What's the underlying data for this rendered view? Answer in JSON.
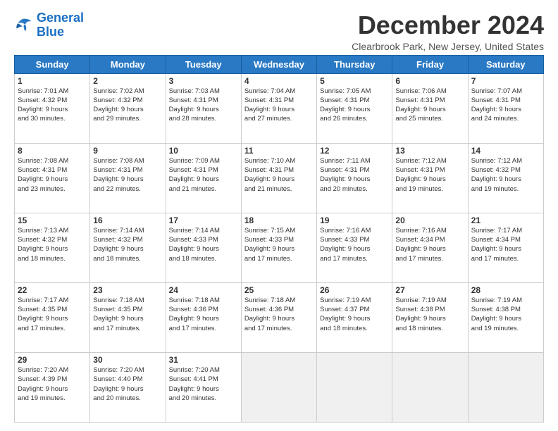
{
  "logo": {
    "line1": "General",
    "line2": "Blue"
  },
  "title": "December 2024",
  "location": "Clearbrook Park, New Jersey, United States",
  "weekdays": [
    "Sunday",
    "Monday",
    "Tuesday",
    "Wednesday",
    "Thursday",
    "Friday",
    "Saturday"
  ],
  "weeks": [
    [
      {
        "day": "1",
        "info": "Sunrise: 7:01 AM\nSunset: 4:32 PM\nDaylight: 9 hours\nand 30 minutes."
      },
      {
        "day": "2",
        "info": "Sunrise: 7:02 AM\nSunset: 4:32 PM\nDaylight: 9 hours\nand 29 minutes."
      },
      {
        "day": "3",
        "info": "Sunrise: 7:03 AM\nSunset: 4:31 PM\nDaylight: 9 hours\nand 28 minutes."
      },
      {
        "day": "4",
        "info": "Sunrise: 7:04 AM\nSunset: 4:31 PM\nDaylight: 9 hours\nand 27 minutes."
      },
      {
        "day": "5",
        "info": "Sunrise: 7:05 AM\nSunset: 4:31 PM\nDaylight: 9 hours\nand 26 minutes."
      },
      {
        "day": "6",
        "info": "Sunrise: 7:06 AM\nSunset: 4:31 PM\nDaylight: 9 hours\nand 25 minutes."
      },
      {
        "day": "7",
        "info": "Sunrise: 7:07 AM\nSunset: 4:31 PM\nDaylight: 9 hours\nand 24 minutes."
      }
    ],
    [
      {
        "day": "8",
        "info": "Sunrise: 7:08 AM\nSunset: 4:31 PM\nDaylight: 9 hours\nand 23 minutes."
      },
      {
        "day": "9",
        "info": "Sunrise: 7:08 AM\nSunset: 4:31 PM\nDaylight: 9 hours\nand 22 minutes."
      },
      {
        "day": "10",
        "info": "Sunrise: 7:09 AM\nSunset: 4:31 PM\nDaylight: 9 hours\nand 21 minutes."
      },
      {
        "day": "11",
        "info": "Sunrise: 7:10 AM\nSunset: 4:31 PM\nDaylight: 9 hours\nand 21 minutes."
      },
      {
        "day": "12",
        "info": "Sunrise: 7:11 AM\nSunset: 4:31 PM\nDaylight: 9 hours\nand 20 minutes."
      },
      {
        "day": "13",
        "info": "Sunrise: 7:12 AM\nSunset: 4:31 PM\nDaylight: 9 hours\nand 19 minutes."
      },
      {
        "day": "14",
        "info": "Sunrise: 7:12 AM\nSunset: 4:32 PM\nDaylight: 9 hours\nand 19 minutes."
      }
    ],
    [
      {
        "day": "15",
        "info": "Sunrise: 7:13 AM\nSunset: 4:32 PM\nDaylight: 9 hours\nand 18 minutes."
      },
      {
        "day": "16",
        "info": "Sunrise: 7:14 AM\nSunset: 4:32 PM\nDaylight: 9 hours\nand 18 minutes."
      },
      {
        "day": "17",
        "info": "Sunrise: 7:14 AM\nSunset: 4:33 PM\nDaylight: 9 hours\nand 18 minutes."
      },
      {
        "day": "18",
        "info": "Sunrise: 7:15 AM\nSunset: 4:33 PM\nDaylight: 9 hours\nand 17 minutes."
      },
      {
        "day": "19",
        "info": "Sunrise: 7:16 AM\nSunset: 4:33 PM\nDaylight: 9 hours\nand 17 minutes."
      },
      {
        "day": "20",
        "info": "Sunrise: 7:16 AM\nSunset: 4:34 PM\nDaylight: 9 hours\nand 17 minutes."
      },
      {
        "day": "21",
        "info": "Sunrise: 7:17 AM\nSunset: 4:34 PM\nDaylight: 9 hours\nand 17 minutes."
      }
    ],
    [
      {
        "day": "22",
        "info": "Sunrise: 7:17 AM\nSunset: 4:35 PM\nDaylight: 9 hours\nand 17 minutes."
      },
      {
        "day": "23",
        "info": "Sunrise: 7:18 AM\nSunset: 4:35 PM\nDaylight: 9 hours\nand 17 minutes."
      },
      {
        "day": "24",
        "info": "Sunrise: 7:18 AM\nSunset: 4:36 PM\nDaylight: 9 hours\nand 17 minutes."
      },
      {
        "day": "25",
        "info": "Sunrise: 7:18 AM\nSunset: 4:36 PM\nDaylight: 9 hours\nand 17 minutes."
      },
      {
        "day": "26",
        "info": "Sunrise: 7:19 AM\nSunset: 4:37 PM\nDaylight: 9 hours\nand 18 minutes."
      },
      {
        "day": "27",
        "info": "Sunrise: 7:19 AM\nSunset: 4:38 PM\nDaylight: 9 hours\nand 18 minutes."
      },
      {
        "day": "28",
        "info": "Sunrise: 7:19 AM\nSunset: 4:38 PM\nDaylight: 9 hours\nand 19 minutes."
      }
    ],
    [
      {
        "day": "29",
        "info": "Sunrise: 7:20 AM\nSunset: 4:39 PM\nDaylight: 9 hours\nand 19 minutes."
      },
      {
        "day": "30",
        "info": "Sunrise: 7:20 AM\nSunset: 4:40 PM\nDaylight: 9 hours\nand 20 minutes."
      },
      {
        "day": "31",
        "info": "Sunrise: 7:20 AM\nSunset: 4:41 PM\nDaylight: 9 hours\nand 20 minutes."
      },
      {
        "day": "",
        "info": ""
      },
      {
        "day": "",
        "info": ""
      },
      {
        "day": "",
        "info": ""
      },
      {
        "day": "",
        "info": ""
      }
    ]
  ]
}
